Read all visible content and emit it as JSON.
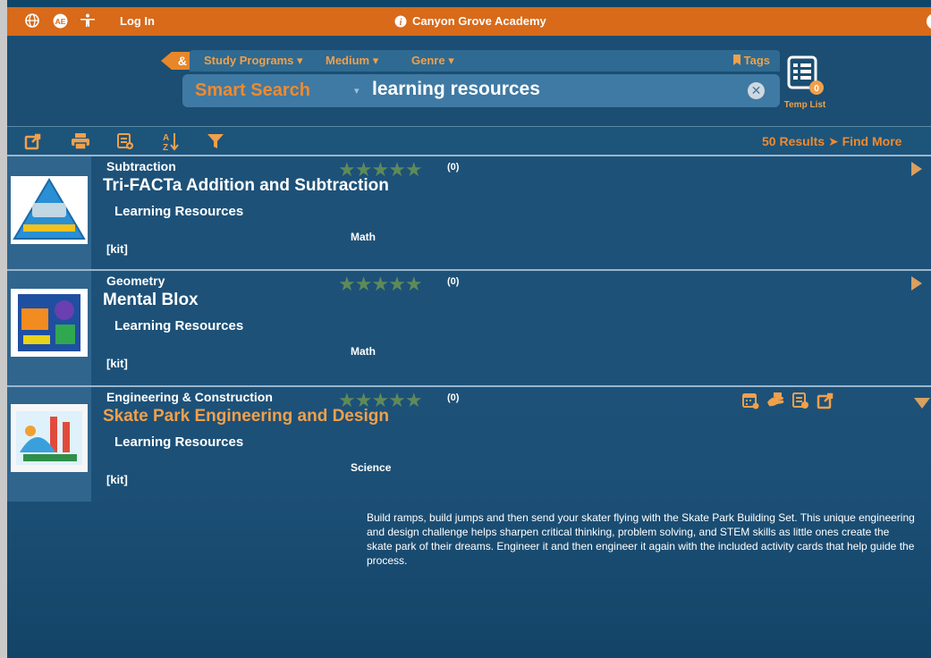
{
  "topbar": {
    "login_label": "Log In",
    "school_name": "Canyon Grove Academy",
    "help_glyph": "?",
    "info_glyph": "i",
    "icons": [
      "globe-icon",
      "language-icon",
      "accessibility-icon"
    ]
  },
  "search": {
    "amp_label": "&",
    "filters": {
      "study_programs": "Study Programs",
      "medium": "Medium",
      "genre": "Genre",
      "tags": "Tags"
    },
    "mode": "Smart Search",
    "query": "learning resources",
    "clear_glyph": "✕",
    "temp_list_label": "Temp List",
    "temp_list_count": "0"
  },
  "toolbar": {
    "results_text": "50 Results",
    "find_more": "Find More",
    "icons": [
      "share-icon",
      "print-icon",
      "list-add-icon",
      "sort-az-icon",
      "filter-icon"
    ]
  },
  "results": [
    {
      "category": "Subtraction",
      "rating_count": "(0)",
      "title": "Tri-FACTa Addition and Subtraction",
      "publisher": "Learning Resources",
      "subject": "Math",
      "format": "[kit]"
    },
    {
      "category": "Geometry",
      "rating_count": "(0)",
      "title": "Mental Blox",
      "publisher": "Learning Resources",
      "subject": "Math",
      "format": "[kit]"
    },
    {
      "category": "Engineering & Construction",
      "rating_count": "(0)",
      "title": "Skate Park Engineering and Design",
      "publisher": "Learning Resources",
      "subject": "Science",
      "format": "[kit]",
      "description": "Build ramps, build jumps and then send your skater flying with the Skate Park Building Set. This unique engineering and design challenge helps sharpen critical thinking, problem solving, and STEM skills as little ones create the skate park of their dreams. Engineer it and then engineer it again with the included activity cards that help guide the process."
    }
  ],
  "colors": {
    "orange": "#d86a1a",
    "accent": "#f08a2e",
    "panel": "#1d5178"
  }
}
